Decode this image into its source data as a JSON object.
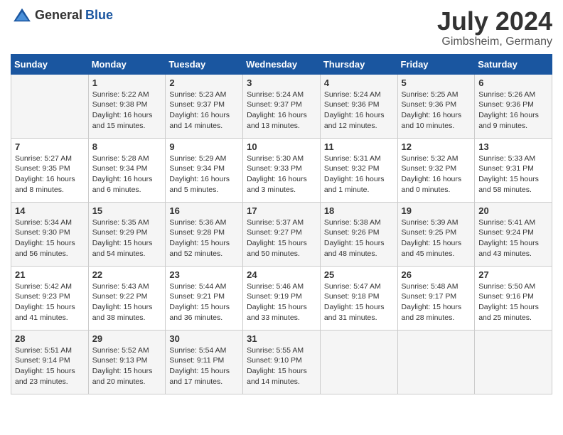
{
  "logo": {
    "general": "General",
    "blue": "Blue"
  },
  "title": {
    "month": "July 2024",
    "location": "Gimbsheim, Germany"
  },
  "calendar": {
    "headers": [
      "Sunday",
      "Monday",
      "Tuesday",
      "Wednesday",
      "Thursday",
      "Friday",
      "Saturday"
    ],
    "weeks": [
      [
        {
          "day": "",
          "sunrise": "",
          "sunset": "",
          "daylight": ""
        },
        {
          "day": "1",
          "sunrise": "Sunrise: 5:22 AM",
          "sunset": "Sunset: 9:38 PM",
          "daylight": "Daylight: 16 hours and 15 minutes."
        },
        {
          "day": "2",
          "sunrise": "Sunrise: 5:23 AM",
          "sunset": "Sunset: 9:37 PM",
          "daylight": "Daylight: 16 hours and 14 minutes."
        },
        {
          "day": "3",
          "sunrise": "Sunrise: 5:24 AM",
          "sunset": "Sunset: 9:37 PM",
          "daylight": "Daylight: 16 hours and 13 minutes."
        },
        {
          "day": "4",
          "sunrise": "Sunrise: 5:24 AM",
          "sunset": "Sunset: 9:36 PM",
          "daylight": "Daylight: 16 hours and 12 minutes."
        },
        {
          "day": "5",
          "sunrise": "Sunrise: 5:25 AM",
          "sunset": "Sunset: 9:36 PM",
          "daylight": "Daylight: 16 hours and 10 minutes."
        },
        {
          "day": "6",
          "sunrise": "Sunrise: 5:26 AM",
          "sunset": "Sunset: 9:36 PM",
          "daylight": "Daylight: 16 hours and 9 minutes."
        }
      ],
      [
        {
          "day": "7",
          "sunrise": "Sunrise: 5:27 AM",
          "sunset": "Sunset: 9:35 PM",
          "daylight": "Daylight: 16 hours and 8 minutes."
        },
        {
          "day": "8",
          "sunrise": "Sunrise: 5:28 AM",
          "sunset": "Sunset: 9:34 PM",
          "daylight": "Daylight: 16 hours and 6 minutes."
        },
        {
          "day": "9",
          "sunrise": "Sunrise: 5:29 AM",
          "sunset": "Sunset: 9:34 PM",
          "daylight": "Daylight: 16 hours and 5 minutes."
        },
        {
          "day": "10",
          "sunrise": "Sunrise: 5:30 AM",
          "sunset": "Sunset: 9:33 PM",
          "daylight": "Daylight: 16 hours and 3 minutes."
        },
        {
          "day": "11",
          "sunrise": "Sunrise: 5:31 AM",
          "sunset": "Sunset: 9:32 PM",
          "daylight": "Daylight: 16 hours and 1 minute."
        },
        {
          "day": "12",
          "sunrise": "Sunrise: 5:32 AM",
          "sunset": "Sunset: 9:32 PM",
          "daylight": "Daylight: 16 hours and 0 minutes."
        },
        {
          "day": "13",
          "sunrise": "Sunrise: 5:33 AM",
          "sunset": "Sunset: 9:31 PM",
          "daylight": "Daylight: 15 hours and 58 minutes."
        }
      ],
      [
        {
          "day": "14",
          "sunrise": "Sunrise: 5:34 AM",
          "sunset": "Sunset: 9:30 PM",
          "daylight": "Daylight: 15 hours and 56 minutes."
        },
        {
          "day": "15",
          "sunrise": "Sunrise: 5:35 AM",
          "sunset": "Sunset: 9:29 PM",
          "daylight": "Daylight: 15 hours and 54 minutes."
        },
        {
          "day": "16",
          "sunrise": "Sunrise: 5:36 AM",
          "sunset": "Sunset: 9:28 PM",
          "daylight": "Daylight: 15 hours and 52 minutes."
        },
        {
          "day": "17",
          "sunrise": "Sunrise: 5:37 AM",
          "sunset": "Sunset: 9:27 PM",
          "daylight": "Daylight: 15 hours and 50 minutes."
        },
        {
          "day": "18",
          "sunrise": "Sunrise: 5:38 AM",
          "sunset": "Sunset: 9:26 PM",
          "daylight": "Daylight: 15 hours and 48 minutes."
        },
        {
          "day": "19",
          "sunrise": "Sunrise: 5:39 AM",
          "sunset": "Sunset: 9:25 PM",
          "daylight": "Daylight: 15 hours and 45 minutes."
        },
        {
          "day": "20",
          "sunrise": "Sunrise: 5:41 AM",
          "sunset": "Sunset: 9:24 PM",
          "daylight": "Daylight: 15 hours and 43 minutes."
        }
      ],
      [
        {
          "day": "21",
          "sunrise": "Sunrise: 5:42 AM",
          "sunset": "Sunset: 9:23 PM",
          "daylight": "Daylight: 15 hours and 41 minutes."
        },
        {
          "day": "22",
          "sunrise": "Sunrise: 5:43 AM",
          "sunset": "Sunset: 9:22 PM",
          "daylight": "Daylight: 15 hours and 38 minutes."
        },
        {
          "day": "23",
          "sunrise": "Sunrise: 5:44 AM",
          "sunset": "Sunset: 9:21 PM",
          "daylight": "Daylight: 15 hours and 36 minutes."
        },
        {
          "day": "24",
          "sunrise": "Sunrise: 5:46 AM",
          "sunset": "Sunset: 9:19 PM",
          "daylight": "Daylight: 15 hours and 33 minutes."
        },
        {
          "day": "25",
          "sunrise": "Sunrise: 5:47 AM",
          "sunset": "Sunset: 9:18 PM",
          "daylight": "Daylight: 15 hours and 31 minutes."
        },
        {
          "day": "26",
          "sunrise": "Sunrise: 5:48 AM",
          "sunset": "Sunset: 9:17 PM",
          "daylight": "Daylight: 15 hours and 28 minutes."
        },
        {
          "day": "27",
          "sunrise": "Sunrise: 5:50 AM",
          "sunset": "Sunset: 9:16 PM",
          "daylight": "Daylight: 15 hours and 25 minutes."
        }
      ],
      [
        {
          "day": "28",
          "sunrise": "Sunrise: 5:51 AM",
          "sunset": "Sunset: 9:14 PM",
          "daylight": "Daylight: 15 hours and 23 minutes."
        },
        {
          "day": "29",
          "sunrise": "Sunrise: 5:52 AM",
          "sunset": "Sunset: 9:13 PM",
          "daylight": "Daylight: 15 hours and 20 minutes."
        },
        {
          "day": "30",
          "sunrise": "Sunrise: 5:54 AM",
          "sunset": "Sunset: 9:11 PM",
          "daylight": "Daylight: 15 hours and 17 minutes."
        },
        {
          "day": "31",
          "sunrise": "Sunrise: 5:55 AM",
          "sunset": "Sunset: 9:10 PM",
          "daylight": "Daylight: 15 hours and 14 minutes."
        },
        {
          "day": "",
          "sunrise": "",
          "sunset": "",
          "daylight": ""
        },
        {
          "day": "",
          "sunrise": "",
          "sunset": "",
          "daylight": ""
        },
        {
          "day": "",
          "sunrise": "",
          "sunset": "",
          "daylight": ""
        }
      ]
    ]
  }
}
